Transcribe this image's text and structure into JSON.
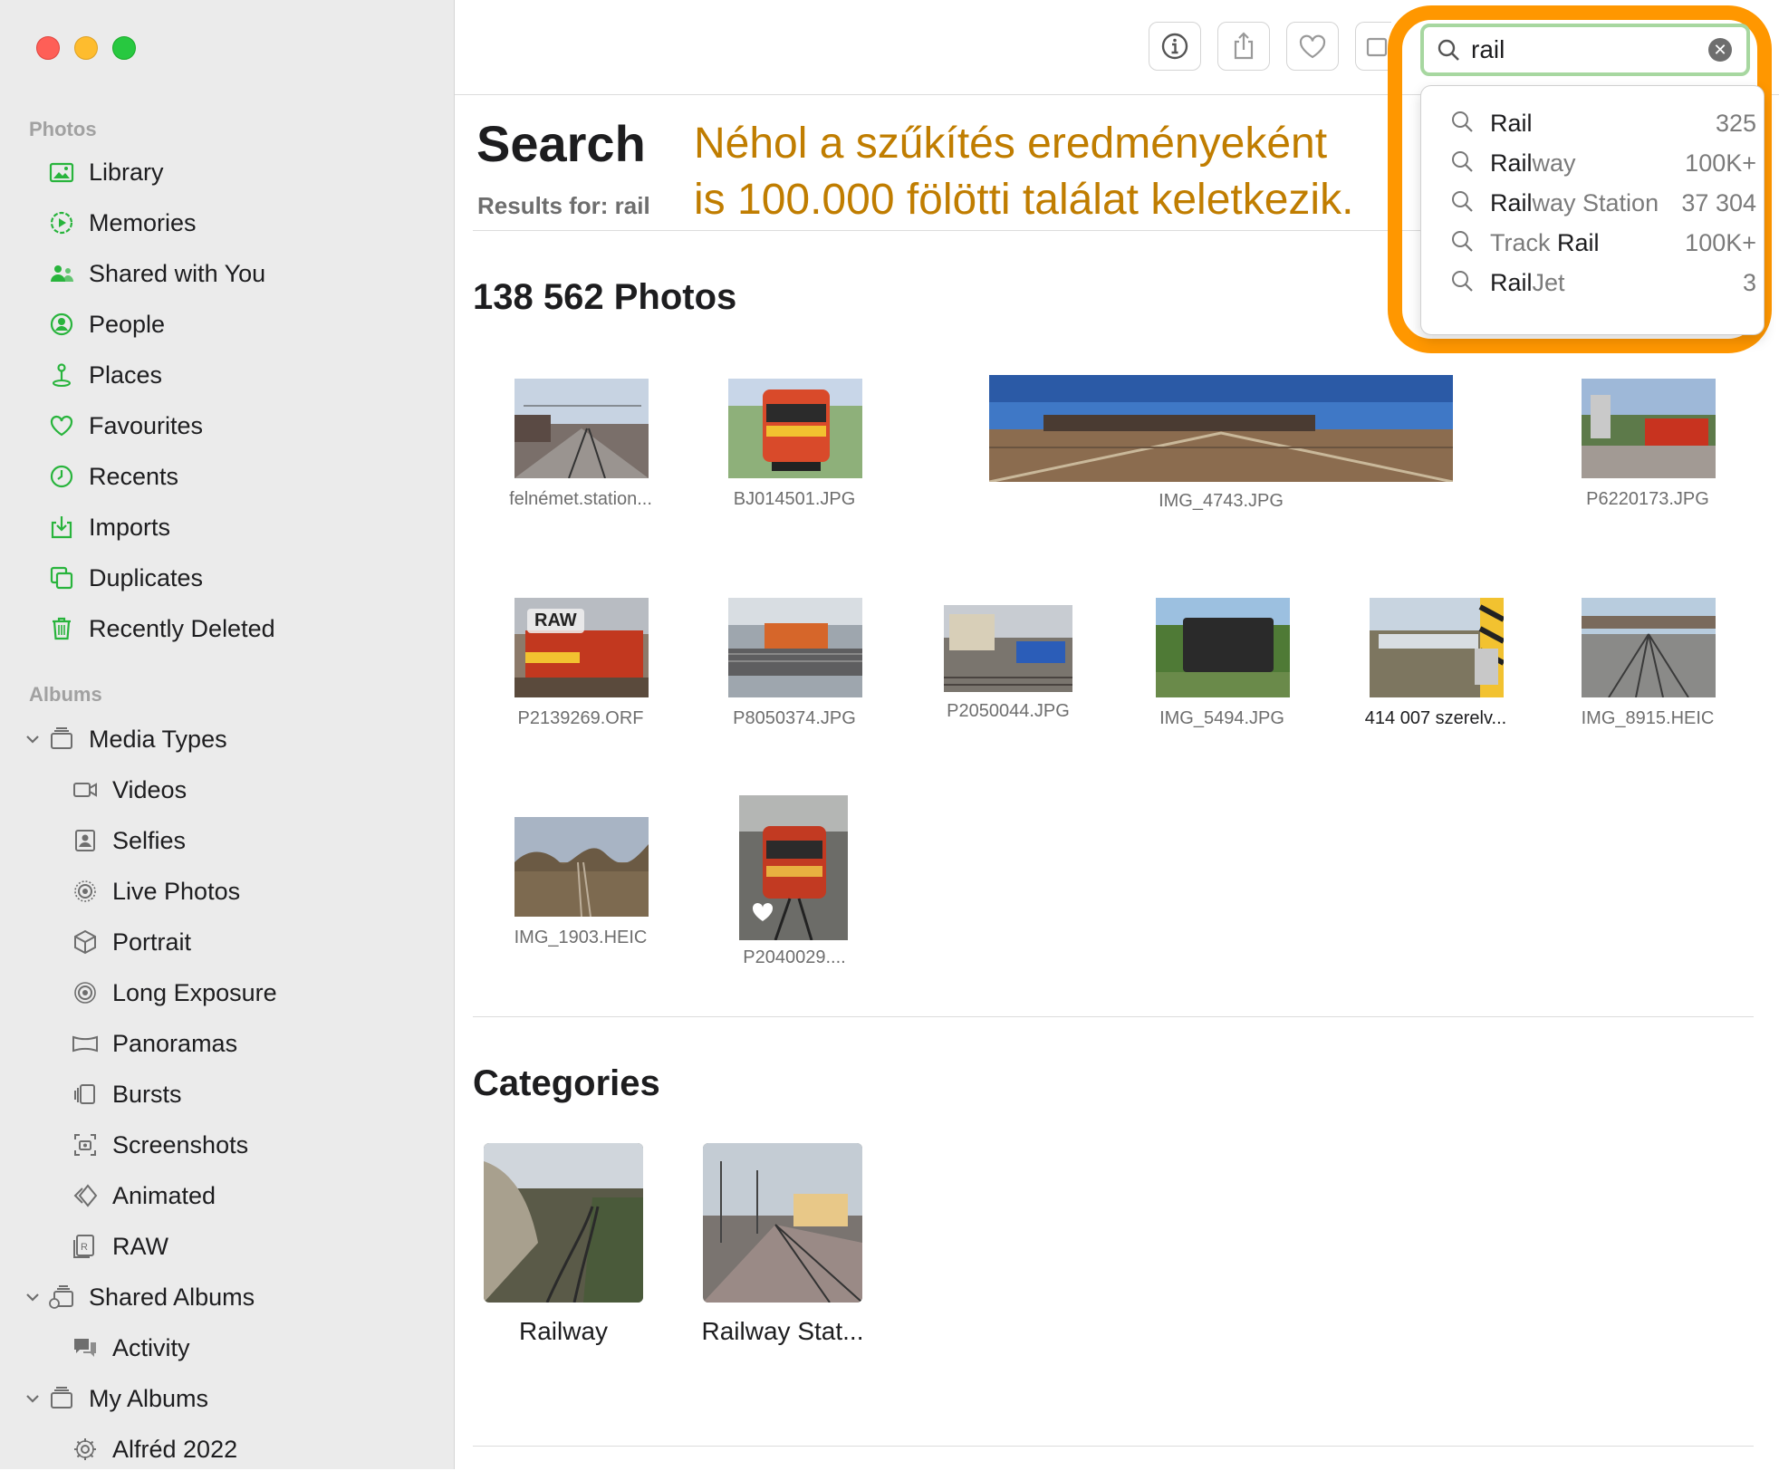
{
  "sidebar": {
    "photos_header": "Photos",
    "photos_items": [
      {
        "label": "Library",
        "icon": "library-icon"
      },
      {
        "label": "Memories",
        "icon": "memories-icon"
      },
      {
        "label": "Shared with You",
        "icon": "shared-with-you-icon"
      },
      {
        "label": "People",
        "icon": "people-icon"
      },
      {
        "label": "Places",
        "icon": "places-icon"
      },
      {
        "label": "Favourites",
        "icon": "heart-icon"
      },
      {
        "label": "Recents",
        "icon": "clock-icon"
      },
      {
        "label": "Imports",
        "icon": "import-icon"
      },
      {
        "label": "Duplicates",
        "icon": "duplicates-icon"
      },
      {
        "label": "Recently Deleted",
        "icon": "trash-icon"
      }
    ],
    "albums_header": "Albums",
    "media_types": "Media Types",
    "media_items": [
      {
        "label": "Videos",
        "icon": "video-icon"
      },
      {
        "label": "Selfies",
        "icon": "selfie-icon"
      },
      {
        "label": "Live Photos",
        "icon": "live-photo-icon"
      },
      {
        "label": "Portrait",
        "icon": "portrait-icon"
      },
      {
        "label": "Long Exposure",
        "icon": "long-exposure-icon"
      },
      {
        "label": "Panoramas",
        "icon": "panorama-icon"
      },
      {
        "label": "Bursts",
        "icon": "bursts-icon"
      },
      {
        "label": "Screenshots",
        "icon": "screenshot-icon"
      },
      {
        "label": "Animated",
        "icon": "animated-icon"
      },
      {
        "label": "RAW",
        "icon": "raw-icon"
      }
    ],
    "shared_albums": "Shared Albums",
    "activity": "Activity",
    "my_albums": "My Albums",
    "alfred": "Alfréd 2022"
  },
  "header": {
    "title": "Search",
    "results_for": "Results for: rail",
    "annotation_line1": "Néhol a szűkítés eredményeként",
    "annotation_line2": "is 100.000 fölötti találat keletkezik."
  },
  "photos": {
    "count_label": "138 562 Photos",
    "items": [
      {
        "name": "felnémet.station..."
      },
      {
        "name": "BJ014501.JPG"
      },
      {
        "name": "IMG_4743.JPG"
      },
      {
        "name": "P6220173.JPG"
      },
      {
        "name": "P2139269.ORF",
        "badge": "RAW"
      },
      {
        "name": "P8050374.JPG"
      },
      {
        "name": "P2050044.JPG"
      },
      {
        "name": "IMG_5494.JPG"
      },
      {
        "name": "414 007 szerelv..."
      },
      {
        "name": "IMG_8915.HEIC"
      },
      {
        "name": "IMG_1903.HEIC"
      },
      {
        "name": "P2040029...."
      }
    ]
  },
  "categories": {
    "title": "Categories",
    "items": [
      "Railway",
      "Railway Stat..."
    ]
  },
  "search": {
    "query": "rail",
    "suggestions": [
      {
        "match": "Rail",
        "rest": "",
        "count": "325"
      },
      {
        "match": "Rail",
        "rest": "way",
        "count": "100K+"
      },
      {
        "match": "Rail",
        "rest": "way Station",
        "count": "37 304"
      },
      {
        "prefix": "Track ",
        "match": "Rail",
        "rest": "",
        "count": "100K+"
      },
      {
        "match": "Rail",
        "rest": "Jet",
        "count": "3"
      }
    ]
  },
  "colors": {
    "accent": "#28b43c",
    "highlight": "#ff9700",
    "annotation": "#c07d00"
  }
}
